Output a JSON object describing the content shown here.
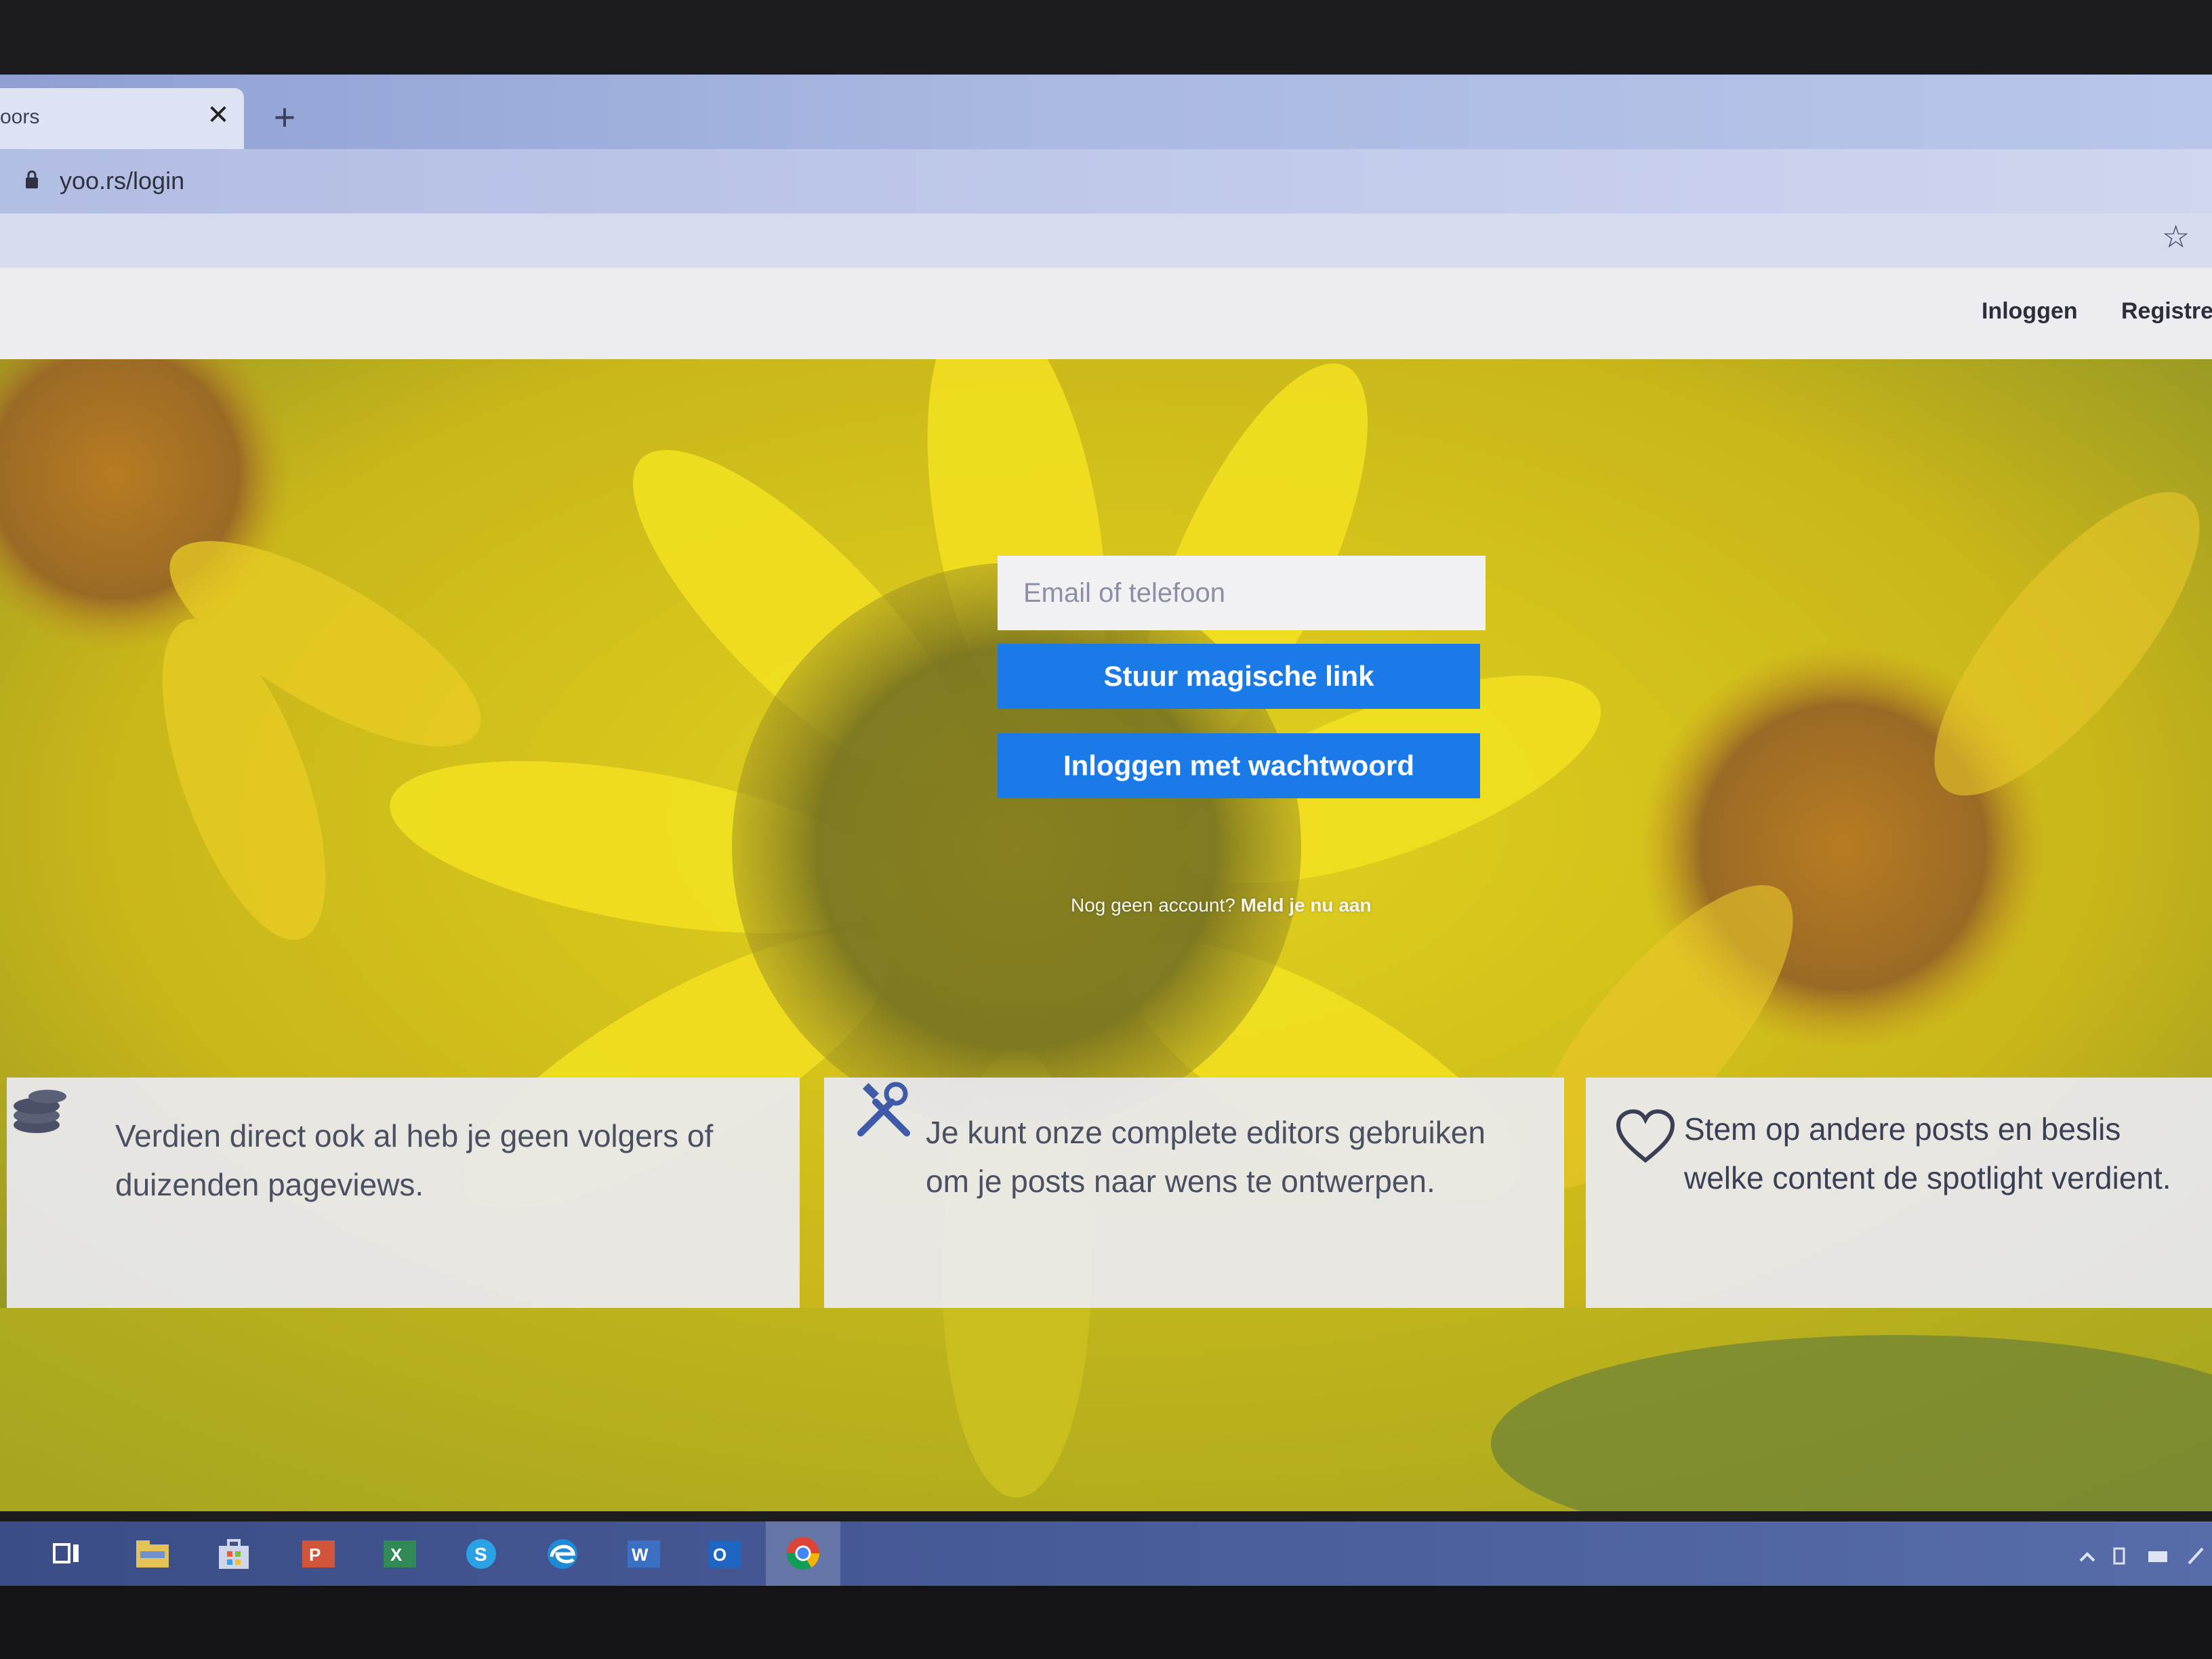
{
  "browser": {
    "tab": {
      "title": "oors",
      "close_label": "✕"
    },
    "new_tab_label": "+",
    "address": {
      "url": "yoo.rs/login"
    }
  },
  "header": {
    "nav": [
      {
        "label": "Inloggen"
      },
      {
        "label": "Registrer"
      }
    ]
  },
  "login": {
    "email_placeholder": "Email of telefoon",
    "magic_link_button": "Stuur magische link",
    "password_button": "Inloggen met wachtwoord",
    "signup_prompt": "Nog geen account?",
    "signup_link": "Meld je nu aan"
  },
  "features": [
    {
      "icon": "coins-icon",
      "text": "Verdien direct ook al heb je geen volgers of duizenden pageviews."
    },
    {
      "icon": "tools-icon",
      "text": "Je kunt onze complete editors gebruiken om je posts naar wens te ontwerpen."
    },
    {
      "icon": "heart-icon",
      "text": "Stem op andere posts en beslis welke content de spotlight verdient."
    }
  ],
  "taskbar": {
    "apps": [
      "task-view-icon",
      "file-explorer-icon",
      "store-icon",
      "powerpoint-icon",
      "excel-icon",
      "skype-icon",
      "edge-icon",
      "word-icon",
      "outlook-icon",
      "chrome-icon"
    ]
  },
  "colors": {
    "primary_button": "#1a7be8",
    "card_background": "#e9e9f0",
    "hero_yellow": "#d8c51a"
  }
}
